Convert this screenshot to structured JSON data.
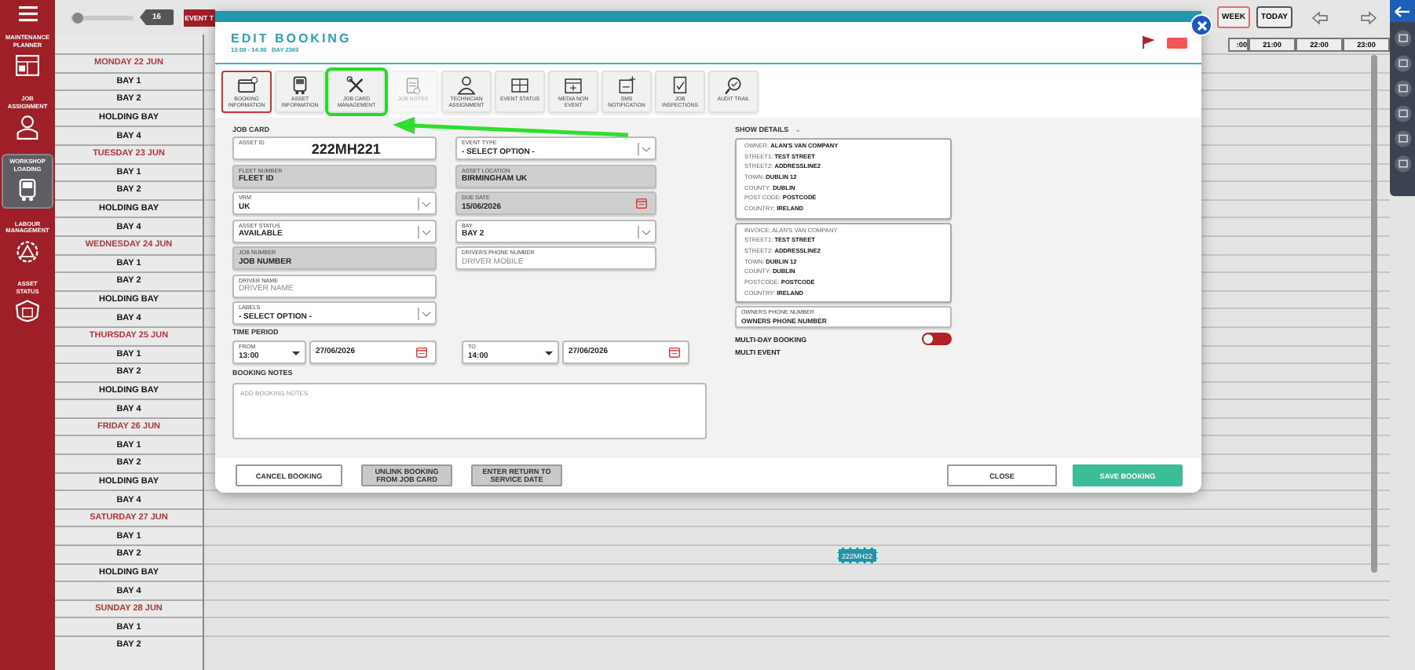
{
  "sidebar": {
    "items": [
      {
        "label": "MAINTENANCE PLANNER",
        "selected": false
      },
      {
        "label": "JOB ASSIGNMENT",
        "selected": false
      },
      {
        "label": "WORKSHOP LOADING",
        "selected": true
      },
      {
        "label": "LABOUR MANAGEMENT",
        "selected": false
      },
      {
        "label": "ASSET STATUS",
        "selected": false
      }
    ]
  },
  "toolbar": {
    "zoom_slider": {
      "level": 0.1
    },
    "zoom_value": "16",
    "event_button": "EVENT T",
    "views": [
      {
        "label": "WEEK",
        "selected": true
      },
      {
        "label": "TODAY",
        "selected": false
      }
    ]
  },
  "hours": [
    ":00",
    "21:00",
    "22:00",
    "23:00"
  ],
  "schedule_rows": [
    {
      "kind": "day",
      "label": "MONDAY 22 JUN"
    },
    {
      "kind": "bay",
      "label": "BAY 1"
    },
    {
      "kind": "bay",
      "label": "BAY 2"
    },
    {
      "kind": "bay",
      "label": "HOLDING BAY"
    },
    {
      "kind": "bay",
      "label": "BAY 4"
    },
    {
      "kind": "day",
      "label": "TUESDAY 23 JUN"
    },
    {
      "kind": "bay",
      "label": "BAY 1"
    },
    {
      "kind": "bay",
      "label": "BAY 2"
    },
    {
      "kind": "bay",
      "label": "HOLDING BAY"
    },
    {
      "kind": "bay",
      "label": "BAY 4"
    },
    {
      "kind": "day",
      "label": "WEDNESDAY 24 JUN"
    },
    {
      "kind": "bay",
      "label": "BAY 1"
    },
    {
      "kind": "bay",
      "label": "BAY 2"
    },
    {
      "kind": "bay",
      "label": "HOLDING BAY"
    },
    {
      "kind": "bay",
      "label": "BAY 4"
    },
    {
      "kind": "day",
      "label": "THURSDAY 25 JUN"
    },
    {
      "kind": "bay",
      "label": "BAY 1"
    },
    {
      "kind": "bay",
      "label": "BAY 2"
    },
    {
      "kind": "bay",
      "label": "HOLDING BAY"
    },
    {
      "kind": "bay",
      "label": "BAY 4"
    },
    {
      "kind": "day",
      "label": "FRIDAY 26 JUN"
    },
    {
      "kind": "bay",
      "label": "BAY 1"
    },
    {
      "kind": "bay",
      "label": "BAY 2"
    },
    {
      "kind": "bay",
      "label": "HOLDING BAY"
    },
    {
      "kind": "bay",
      "label": "BAY 4"
    },
    {
      "kind": "day",
      "label": "SATURDAY 27 JUN"
    },
    {
      "kind": "bay",
      "label": "BAY 1"
    },
    {
      "kind": "bay",
      "label": "BAY 2",
      "booking": "222MH22"
    },
    {
      "kind": "bay",
      "label": "HOLDING BAY"
    },
    {
      "kind": "bay",
      "label": "BAY 4"
    },
    {
      "kind": "day",
      "label": "SUNDAY 28 JUN"
    },
    {
      "kind": "bay",
      "label": "BAY 1"
    },
    {
      "kind": "bay",
      "label": "BAY 2"
    }
  ],
  "modal": {
    "title": "EDIT BOOKING",
    "subtitle": "13:00 - 14:00   BAY 2369",
    "tabs": [
      {
        "label": "BOOKING INFORMATION",
        "selected": true,
        "disabled": false,
        "highlighted": false
      },
      {
        "label": "ASSET INFORMATION",
        "selected": false,
        "disabled": false,
        "highlighted": false
      },
      {
        "label": "JOB CARD MANAGEMENT",
        "selected": false,
        "disabled": false,
        "highlighted": true
      },
      {
        "label": "JOB NOTES",
        "selected": false,
        "disabled": true,
        "highlighted": false
      },
      {
        "label": "TECHNICIAN ASSIGNMENT",
        "selected": false,
        "disabled": false,
        "highlighted": false
      },
      {
        "label": "EVENT STATUS",
        "selected": false,
        "disabled": false,
        "highlighted": false
      },
      {
        "label": "MEDIA NON EVENT",
        "selected": false,
        "disabled": false,
        "highlighted": false
      },
      {
        "label": "SMS NOTIFICATION",
        "selected": false,
        "disabled": false,
        "highlighted": false
      },
      {
        "label": "JOB INSPECTIONS",
        "selected": false,
        "disabled": false,
        "highlighted": false
      },
      {
        "label": "AUDIT TRAIL",
        "selected": false,
        "disabled": false,
        "highlighted": false
      }
    ],
    "section_title": "JOB CARD",
    "left_fields": [
      {
        "kind": "id",
        "label": "ASSET ID",
        "value": "222MH221",
        "readonly": false
      },
      {
        "kind": "text",
        "label": "FLEET NUMBER",
        "value": "FLEET ID",
        "readonly": true
      },
      {
        "kind": "select",
        "label": "VRM",
        "value": "UK",
        "readonly": false
      },
      {
        "kind": "select",
        "label": "ASSET STATUS",
        "value": "AVAILABLE",
        "readonly": false
      },
      {
        "kind": "text",
        "label": "JOB NUMBER",
        "value": "JOB NUMBER",
        "readonly": true
      },
      {
        "kind": "text",
        "label": "DRIVER NAME",
        "placeholder": "DRIVER NAME",
        "readonly": false
      },
      {
        "kind": "select",
        "label": "LABELS",
        "value": "- SELECT OPTION -",
        "readonly": false
      }
    ],
    "right_fields": [
      {
        "kind": "select",
        "label": "EVENT TYPE",
        "value": "- SELECT OPTION -",
        "readonly": false
      },
      {
        "kind": "text",
        "label": "ASSET LOCATION",
        "value": "BIRMINGHAM UK",
        "readonly": true
      },
      {
        "kind": "date",
        "label": "DUE DATE",
        "value": "15/06/2026",
        "readonly": true
      },
      {
        "kind": "select",
        "label": "BAY",
        "value": "BAY 2",
        "readonly": false
      },
      {
        "kind": "text",
        "label": "DRIVERS PHONE NUMBER",
        "placeholder": "DRIVER MOBILE",
        "readonly": false
      }
    ],
    "time_period": {
      "label": "TIME PERIOD",
      "from": {
        "label": "FROM",
        "time": "13:00",
        "date": "27/06/2026"
      },
      "to": {
        "label": "TO",
        "time": "14:00",
        "date": "27/06/2026"
      }
    },
    "notes": {
      "label": "BOOKING NOTES",
      "placeholder": "ADD BOOKING NOTES"
    },
    "details": {
      "label": "SHOW DETAILS",
      "toggle": "⌄",
      "owner": [
        "OWNER: **ALAN'S VAN COMPANY**",
        "STREET1: **TEST STREET**",
        "STREET2: **ADDRESSLINE2**",
        "TOWN: **DUBLIN 12**",
        "COUNTY: **DUBLIN**",
        "POST CODE: **POSTCODE**",
        "COUNTRY: **IRELAND**"
      ],
      "invoice": [
        "INVOICE: ALAN'S VAN COMPANY",
        "STREET1: **TEST STREET**",
        "STREET2: **ADDRESSLINE2**",
        "TOWN: **DUBLIN 12**",
        "COUNTY: **DUBLIN**",
        "POSTCODE: **POSTCODE**",
        "COUNTRY: **IRELAND**"
      ],
      "phone": {
        "label": "OWNERS PHONE NUMBER",
        "value": "OWNERS PHONE NUMBER"
      }
    },
    "multi_day": {
      "label": "MULTI-DAY BOOKING",
      "on": false
    },
    "multi_event": "MULTI EVENT",
    "footer_left": [
      {
        "label": "CANCEL BOOKING",
        "kind": "outline"
      },
      {
        "label": "UNLINK BOOKING FROM JOB CARD",
        "kind": "grey"
      },
      {
        "label": "ENTER RETURN TO SERVICE DATE",
        "kind": "grey"
      }
    ],
    "footer_right": [
      {
        "label": "CLOSE",
        "kind": "outline"
      },
      {
        "label": "SAVE BOOKING",
        "kind": "primary"
      }
    ]
  }
}
